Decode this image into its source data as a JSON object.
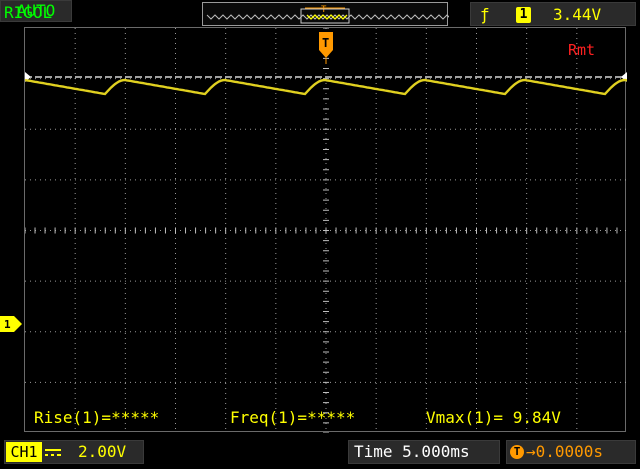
{
  "header": {
    "brand": "RIGOL",
    "trigger_mode": "AUTO",
    "trigger_slope_glyph": "ƒ",
    "trigger_source": "1",
    "trigger_level": "3.44V"
  },
  "screen": {
    "remote_indicator": "Rmt",
    "trigger_position_marker": "T",
    "channel_marker": "1"
  },
  "measurements": {
    "rise": "Rise(1)=*****",
    "freq": "Freq(1)=*****",
    "vmax": "Vmax(1)= 9.84V"
  },
  "footer": {
    "channel_label": "CH1",
    "channel_scale": "2.00V",
    "time_base": "Time 5.000ms",
    "trigger_offset": "→0.0000s",
    "trigger_offset_icon": "T"
  },
  "colors": {
    "trace": "#e0d020",
    "grid": "#c0c0c0",
    "trigger_level_line": "#ffffff",
    "trigger_marker": "#ff9900",
    "status_green": "#00ff00"
  }
}
